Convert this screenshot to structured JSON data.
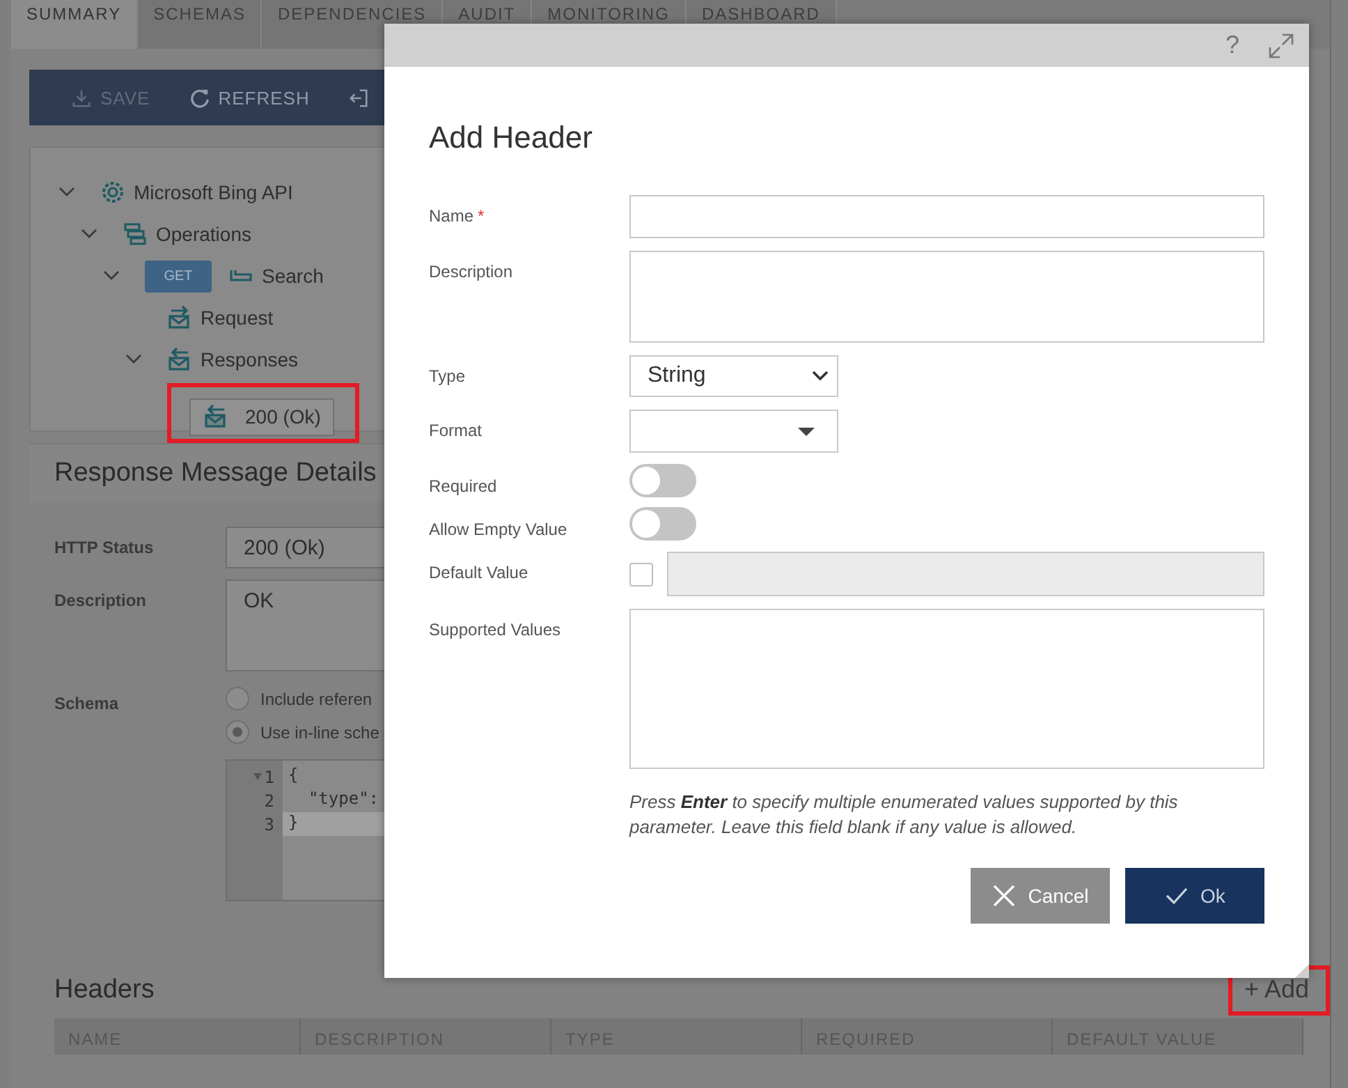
{
  "tabs": [
    {
      "label": "SUMMARY",
      "selected": true
    },
    {
      "label": "SCHEMAS",
      "selected": false
    },
    {
      "label": "DEPENDENCIES",
      "selected": false
    },
    {
      "label": "AUDIT",
      "selected": false
    },
    {
      "label": "MONITORING",
      "selected": false
    },
    {
      "label": "DASHBOARD",
      "selected": false
    }
  ],
  "toolbar": [
    {
      "kind": "save",
      "label": "SAVE",
      "disabled": true
    },
    {
      "kind": "refresh",
      "label": "REFRESH",
      "disabled": false
    },
    {
      "kind": "exit"
    }
  ],
  "tree": [
    {
      "kind": "api",
      "label": "Microsoft Bing API",
      "expanded": true,
      "children": [
        {
          "kind": "operations",
          "label": "Operations",
          "expanded": true,
          "children": [
            {
              "kind": "operation",
              "method": "GET",
              "label": "Search",
              "expanded": true,
              "children": [
                {
                  "kind": "request",
                  "label": "Request"
                },
                {
                  "kind": "responses",
                  "label": "Responses",
                  "expanded": true,
                  "children": [
                    {
                      "kind": "response",
                      "label": "200 (Ok)",
                      "selected": true,
                      "highlighted": true
                    }
                  ]
                }
              ]
            }
          ]
        }
      ]
    }
  ],
  "details": {
    "title": "Response Message Details",
    "fields": [
      {
        "kind": "input",
        "label": "HTTP Status",
        "value": "200 (Ok)"
      },
      {
        "kind": "textarea",
        "label": "Description",
        "value": "OK"
      },
      {
        "kind": "radios",
        "label": "Schema",
        "options": [
          {
            "label": "Include referen",
            "selected": false
          },
          {
            "label": "Use in-line sche",
            "selected": true
          }
        ]
      },
      {
        "kind": "code",
        "lines": [
          {
            "number": "1",
            "text": "{",
            "foldable": true,
            "current": false
          },
          {
            "number": "2",
            "text": "  \"type\":",
            "foldable": false,
            "current": false
          },
          {
            "number": "3",
            "text": "}",
            "foldable": false,
            "current": true
          }
        ]
      }
    ]
  },
  "headers": {
    "title": "Headers",
    "add_button": {
      "label": "+ Add",
      "highlighted": true
    },
    "columns": [
      "NAME",
      "DESCRIPTION",
      "TYPE",
      "REQUIRED",
      "DEFAULT VALUE"
    ]
  },
  "modal": {
    "help": "?",
    "title": "Add Header",
    "fields": [
      {
        "kind": "text",
        "label": "Name",
        "required_mark": "*"
      },
      {
        "kind": "textarea",
        "label": "Description"
      },
      {
        "kind": "select",
        "label": "Type",
        "value": "String"
      },
      {
        "kind": "combo",
        "label": "Format"
      },
      {
        "kind": "toggle",
        "label": "Required",
        "on": false
      },
      {
        "kind": "toggle",
        "label": "Allow Empty Value",
        "on": false
      },
      {
        "kind": "default",
        "label": "Default Value",
        "checked": false
      },
      {
        "kind": "tall",
        "label": "Supported Values",
        "hint": "Press **Enter** to specify multiple enumerated values supported by this parameter. Leave this field blank if any value is allowed."
      }
    ],
    "buttons": [
      {
        "kind": "cancel",
        "label": "Cancel"
      },
      {
        "kind": "ok",
        "label": "Ok"
      }
    ]
  }
}
